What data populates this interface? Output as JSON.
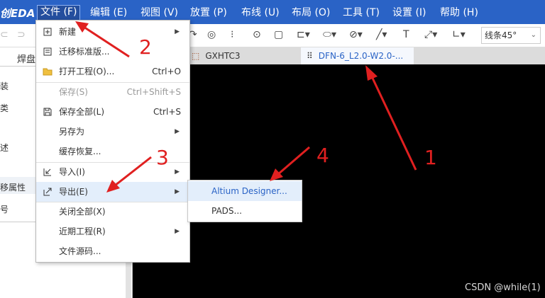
{
  "app": {
    "logo": "创EDA"
  },
  "menubar": [
    {
      "label": "文件 (F)",
      "active": true
    },
    {
      "label": "编辑 (E)"
    },
    {
      "label": "视图 (V)"
    },
    {
      "label": "放置 (P)"
    },
    {
      "label": "布线 (U)"
    },
    {
      "label": "布局 (O)"
    },
    {
      "label": "工具 (T)"
    },
    {
      "label": "设置 (I)"
    },
    {
      "label": "帮助 (H)"
    }
  ],
  "toolbar": {
    "line_mode": "线条45°",
    "icons": [
      "undo-icon",
      "redo-icon",
      "arc-icon",
      "circle-icon",
      "dotted-line-icon",
      "via-icon",
      "rounded-rect-icon",
      "polyline-icon",
      "ellipse-icon",
      "no-icon",
      "line-icon",
      "text-icon",
      "dimension-icon",
      "angle-icon"
    ]
  },
  "left_panel": {
    "tab": "焊盘",
    "items": [
      "装",
      "类",
      "述",
      "移属性",
      "号"
    ]
  },
  "tabs": [
    {
      "label": "GXHTC3",
      "icon": "chip-icon"
    },
    {
      "label": "DFN-6_L2.0-W2.0-...",
      "icon": "footprint-icon",
      "active": true
    }
  ],
  "file_menu": [
    {
      "label": "新建",
      "submenu": true,
      "icon": "new-icon"
    },
    {
      "label": "迁移标准版...",
      "icon": "migrate-icon"
    },
    {
      "label": "打开工程(O)...",
      "shortcut": "Ctrl+O",
      "icon": "folder-icon"
    },
    {
      "label": "保存(S)",
      "shortcut": "Ctrl+Shift+S",
      "disabled": true
    },
    {
      "label": "保存全部(L)",
      "shortcut": "Ctrl+S",
      "icon": "save-icon"
    },
    {
      "label": "另存为",
      "submenu": true
    },
    {
      "label": "缓存恢复..."
    },
    {
      "label": "导入(I)",
      "submenu": true,
      "icon": "import-icon"
    },
    {
      "label": "导出(E)",
      "submenu": true,
      "icon": "export-icon",
      "hover": true
    },
    {
      "label": "关闭全部(X)"
    },
    {
      "label": "近期工程(R)",
      "submenu": true
    },
    {
      "label": "文件源码..."
    }
  ],
  "export_submenu": [
    {
      "label": "Altium Designer...",
      "hover": true
    },
    {
      "label": "PADS..."
    }
  ],
  "annotations": [
    "1",
    "2",
    "3",
    "4"
  ],
  "watermark": "CSDN @while(1)",
  "colors": {
    "menubar": "#2a63c6",
    "annotation": "#e02020",
    "hover": "#e3eefb",
    "canvas": "#000000"
  }
}
